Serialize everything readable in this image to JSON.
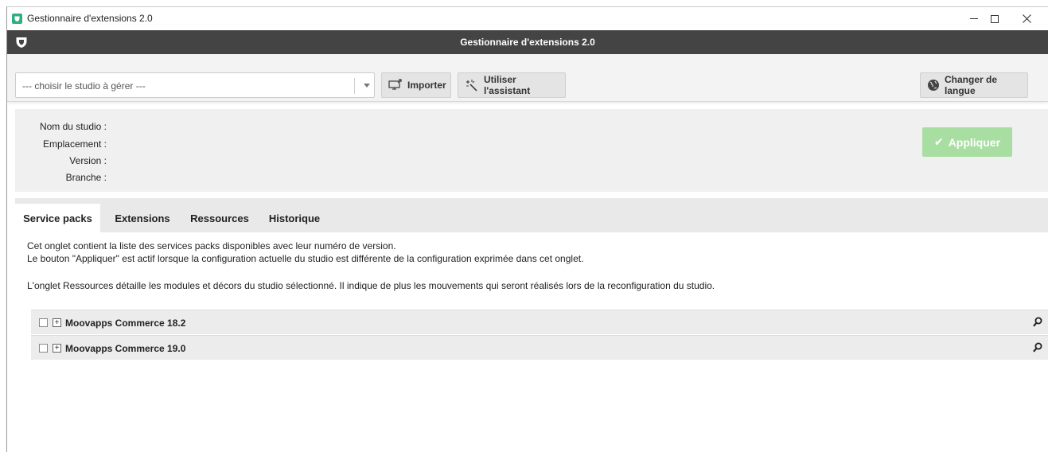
{
  "window": {
    "title": "Gestionnaire d'extensions 2.0"
  },
  "header": {
    "title": "Gestionnaire d'extensions 2.0"
  },
  "toolbar": {
    "studio_select_placeholder": "--- choisir le studio à gérer ---",
    "import_label": "Importer",
    "wizard_label": "Utiliser l'assistant",
    "language_label": "Changer de langue"
  },
  "studio_info": {
    "name_label": "Nom du studio :",
    "location_label": "Emplacement :",
    "version_label": "Version :",
    "branch_label": "Branche :",
    "apply_label": "Appliquer"
  },
  "tabs": [
    {
      "label": "Service packs",
      "active": true
    },
    {
      "label": "Extensions",
      "active": false
    },
    {
      "label": "Ressources",
      "active": false
    },
    {
      "label": "Historique",
      "active": false
    }
  ],
  "description": {
    "line1": "Cet onglet contient la liste des services packs disponibles avec leur numéro de version.",
    "line2": "Le bouton \"Appliquer\" est actif lorsque la configuration actuelle du studio est différente de la configuration exprimée dans cet onglet.",
    "line3": "L'onglet Ressources détaille les modules et décors du studio sélectionné. Il indique de plus les mouvements qui seront réalisés lors de la reconfiguration du studio."
  },
  "service_packs": [
    {
      "name": "Moovapps Commerce 18.2"
    },
    {
      "name": "Moovapps Commerce 19.0"
    }
  ],
  "colors": {
    "header_bg": "#444444",
    "apply_bg": "#a9dea2",
    "app_icon": "#2fb07f"
  }
}
